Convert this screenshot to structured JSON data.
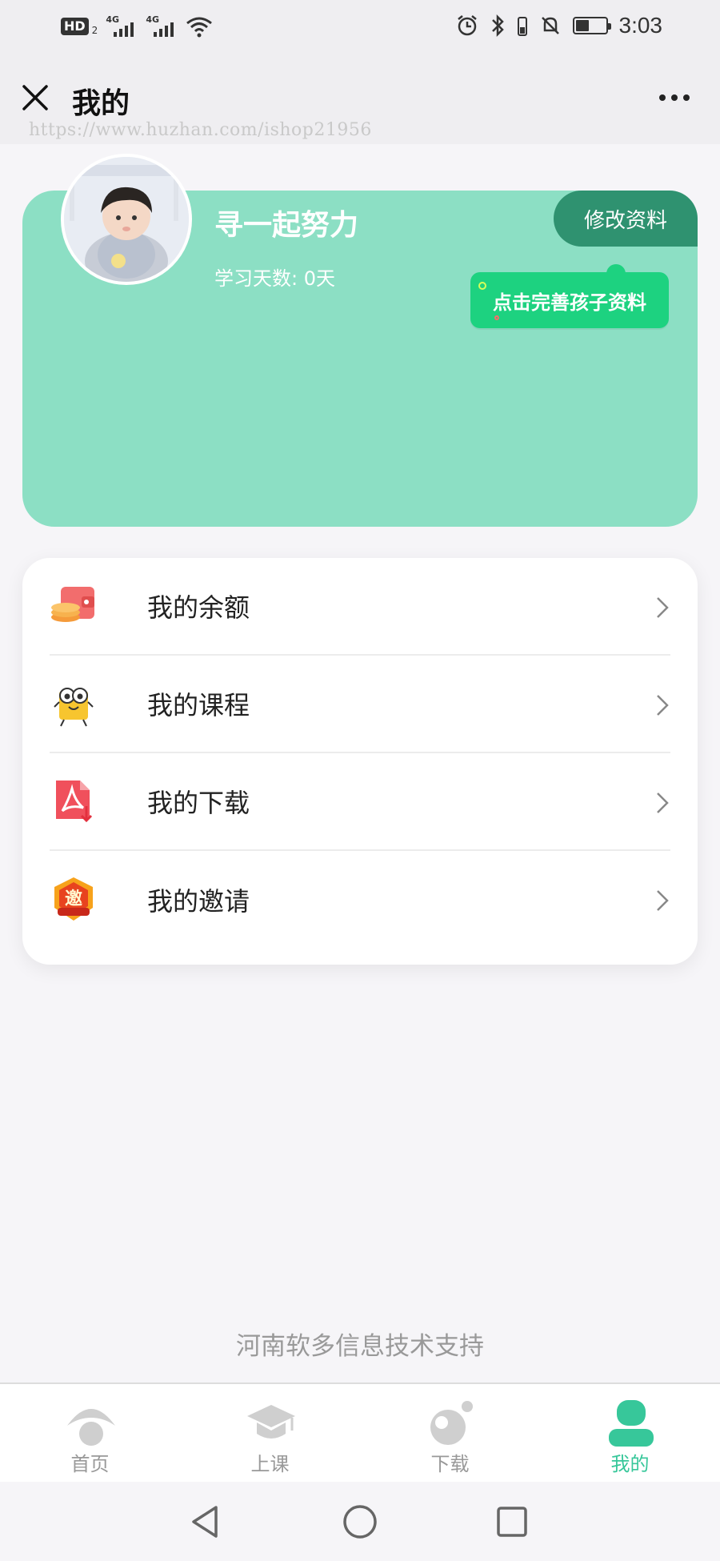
{
  "status_bar": {
    "hd_label": "HD",
    "hd_sub": "2",
    "signal1_tag": "4G",
    "signal2_tag": "4G",
    "time": "3:03"
  },
  "title_bar": {
    "title": "我的",
    "watermark": "https://www.huzhan.com/ishop21956"
  },
  "profile": {
    "name": "寻一起努力",
    "study_days": "学习天数: 0天",
    "edit_button": "修改资料",
    "tip": "点击完善孩子资料",
    "card_color": "#8cdfc4",
    "edit_color": "#2f9270",
    "tip_color": "#1dd280"
  },
  "menu": {
    "items": [
      {
        "label": "我的余额",
        "icon": "wallet-coins-icon"
      },
      {
        "label": "我的课程",
        "icon": "course-mascot-icon"
      },
      {
        "label": "我的下载",
        "icon": "pdf-download-icon"
      },
      {
        "label": "我的邀请",
        "icon": "invite-badge-icon"
      }
    ]
  },
  "footer": {
    "support_text": "河南软多信息技术支持"
  },
  "tab_bar": {
    "tabs": [
      {
        "label": "首页",
        "icon": "home-icon",
        "active": false
      },
      {
        "label": "上课",
        "icon": "graduation-cap-icon",
        "active": false
      },
      {
        "label": "下载",
        "icon": "download-ball-icon",
        "active": false
      },
      {
        "label": "我的",
        "icon": "profile-icon",
        "active": true
      }
    ],
    "active_color": "#37c79a",
    "inactive_color": "#cccccc"
  }
}
